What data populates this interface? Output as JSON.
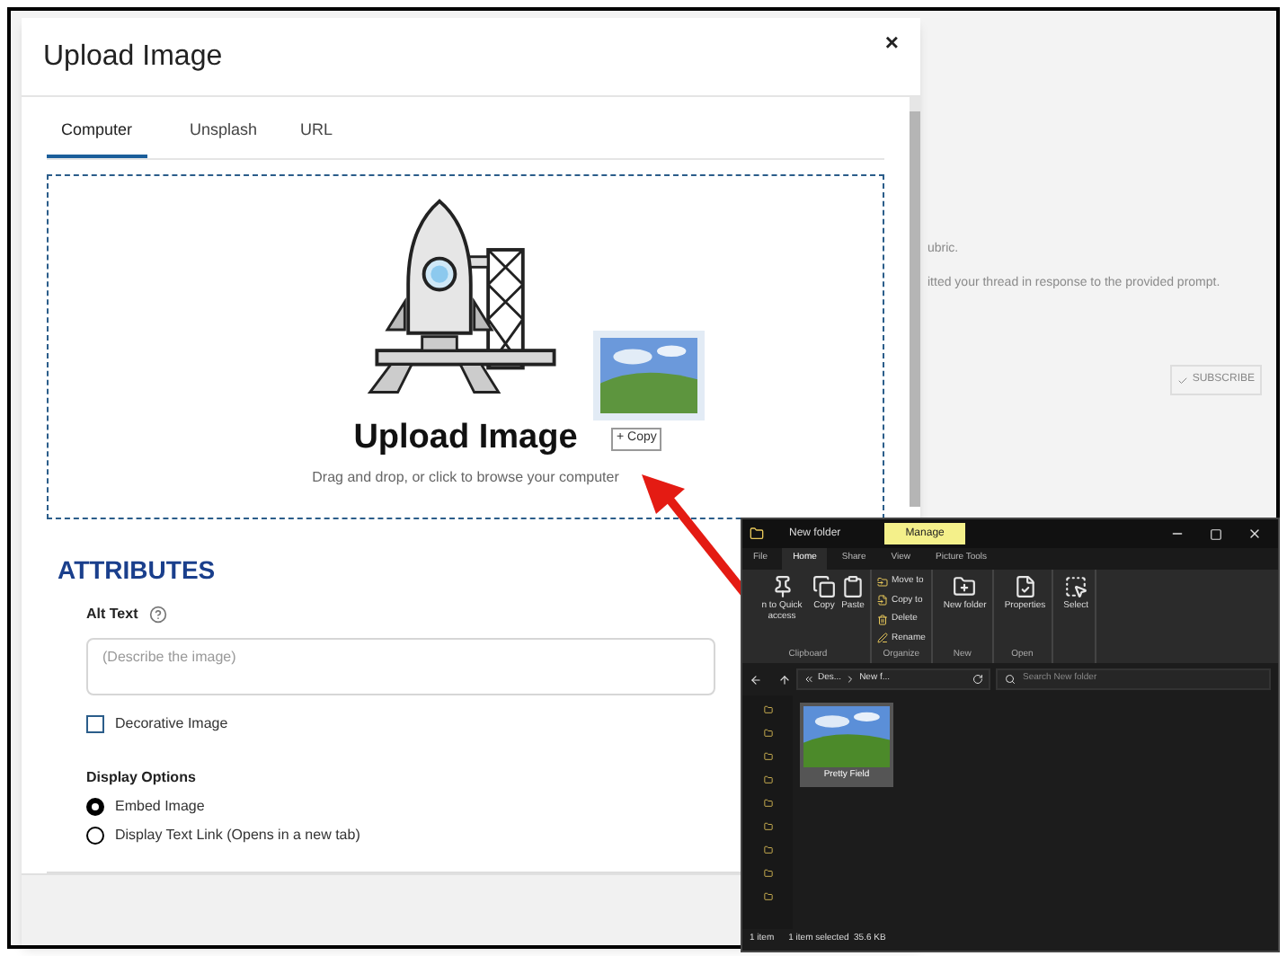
{
  "background_page": {
    "lines": [
      "ubric.",
      "itted your thread in response to the provided prompt."
    ],
    "subscribe_button": "SUBSCRIBE"
  },
  "dialog": {
    "title": "Upload Image",
    "close": "×",
    "tabs": [
      {
        "label": "Computer",
        "selected": true
      },
      {
        "label": "Unsplash",
        "selected": false
      },
      {
        "label": "URL",
        "selected": false
      }
    ],
    "dropzone": {
      "heading": "Upload Image",
      "hint": "Drag and drop, or click to browse your computer"
    },
    "attributes": {
      "heading": "ATTRIBUTES",
      "alt_text_label": "Alt Text",
      "alt_text_placeholder": "(Describe the image)",
      "decorative": {
        "label": "Decorative Image",
        "checked": false
      },
      "display_options": {
        "label": "Display Options",
        "options": [
          {
            "label": "Embed Image",
            "selected": true
          },
          {
            "label": "Display Text Link (Opens in a new tab)",
            "selected": false
          }
        ]
      }
    }
  },
  "drag_ghost": {
    "badge": "+ Copy"
  },
  "explorer": {
    "title": "New folder",
    "context_tab": "Manage",
    "tabs": [
      {
        "label": "File",
        "selected": false
      },
      {
        "label": "Home",
        "selected": true
      },
      {
        "label": "Share",
        "selected": false
      },
      {
        "label": "View",
        "selected": false
      },
      {
        "label": "Picture Tools",
        "selected": false
      }
    ],
    "ribbon": [
      {
        "name": "Clipboard",
        "items": [
          {
            "label": "n to Quick access",
            "kind": "large"
          },
          {
            "label": "Copy",
            "kind": "large"
          },
          {
            "label": "Paste",
            "kind": "large"
          }
        ]
      },
      {
        "name": "Organize",
        "items": [
          {
            "label": "Move to",
            "kind": "small"
          },
          {
            "label": "Copy to",
            "kind": "small"
          },
          {
            "label": "Delete",
            "kind": "small"
          },
          {
            "label": "Rename",
            "kind": "small"
          }
        ]
      },
      {
        "name": "New",
        "items": [
          {
            "label": "New folder",
            "kind": "large"
          }
        ]
      },
      {
        "name": "Open",
        "items": [
          {
            "label": "Properties",
            "kind": "large"
          }
        ]
      },
      {
        "items": [
          {
            "label": "Select",
            "kind": "large"
          }
        ]
      }
    ],
    "address": [
      "Des...",
      "New f..."
    ],
    "search_placeholder": "Search New folder",
    "files": [
      {
        "name": "Pretty Field",
        "selected": true
      }
    ],
    "status": [
      "1 item",
      "1 item selected  35.6 KB"
    ]
  }
}
